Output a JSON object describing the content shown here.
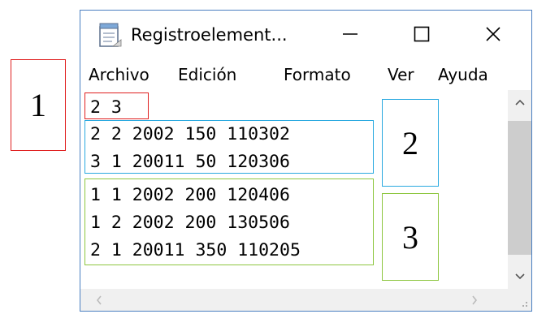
{
  "window": {
    "title": "Registroelement...",
    "icon": "notepad-icon",
    "controls": {
      "minimize": "minimize-icon",
      "maximize": "maximize-icon",
      "close": "close-icon"
    }
  },
  "menu": {
    "items": [
      {
        "label": "Archivo"
      },
      {
        "label": "Edición"
      },
      {
        "label": "Formato"
      },
      {
        "label": "Ver"
      },
      {
        "label": "Ayuda"
      }
    ]
  },
  "editor": {
    "lines": [
      "2 3",
      "2 2 2002 150 110302",
      "3 1 20011 50 120306",
      "1 1 2002 200 120406",
      "1 2 2002 200 130506",
      "2 1 20011 350 110205"
    ]
  },
  "annotations": {
    "labels": [
      "1",
      "2",
      "3"
    ],
    "colors": {
      "one": "#e02020",
      "two": "#29a9e0",
      "three": "#8dc63f"
    }
  }
}
